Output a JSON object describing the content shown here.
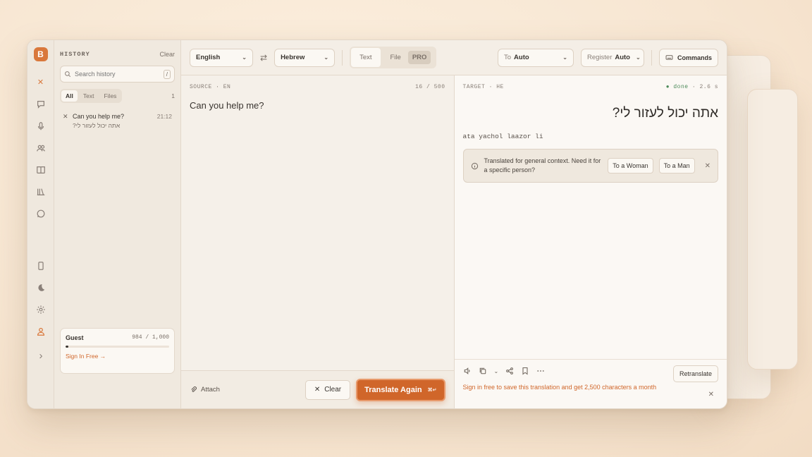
{
  "rail": {
    "brand": "B",
    "close_glyph": "✕",
    "icons": [
      "close-icon",
      "chat-icon",
      "microphone-icon",
      "people-icon",
      "book-icon",
      "library-icon",
      "whatsapp-icon"
    ],
    "bottom_icons": [
      "phone-icon",
      "moon-icon",
      "gear-icon",
      "user-icon"
    ],
    "expand_glyph": "›"
  },
  "history": {
    "title": "HISTORY",
    "clear_label": "Clear",
    "search_placeholder": "Search history",
    "search_shortcut": "/",
    "filters": [
      "All",
      "Text",
      "Files"
    ],
    "count": "1",
    "items": [
      {
        "remove_glyph": "✕",
        "source": "Can you help me?",
        "time": "21:12",
        "target": "אתה יכול לעזור לי?"
      }
    ]
  },
  "guest": {
    "name": "Guest",
    "quota": "984 / 1,000",
    "used_fraction": 0.016,
    "sign_in_label": "Sign In Free →"
  },
  "toolbar": {
    "source_lang": "English",
    "swap_glyph": "⇄",
    "target_lang": "Hebrew",
    "mode_text": "Text",
    "mode_file": "File",
    "pro_badge": "PRO",
    "to_label": "To",
    "to_value": "Auto",
    "register_label": "Register",
    "register_value": "Auto",
    "commands_label": "Commands"
  },
  "source": {
    "head": "SOURCE · EN",
    "char_count": "16 / 500",
    "text": "Can you help me?",
    "attach_label": "Attach",
    "clear_label": "Clear",
    "translate_label": "Translate Again",
    "translate_shortcut": "⌘↵"
  },
  "target": {
    "head": "TARGET · HE",
    "status": "● done",
    "duration": "· 2.6 s",
    "text": "אתה יכול לעזור לי?",
    "transliteration": "ata yachol laazor li",
    "notice": "Translated for general context. Need it for a specific person?",
    "woman_label": "To a Woman",
    "man_label": "To a Man",
    "retranslate_label": "Retranslate",
    "signin_note": "Sign in free to save this translation and get 2,500 characters a month"
  },
  "colors": {
    "accent": "#d0662a",
    "done": "#4d8b5a"
  }
}
